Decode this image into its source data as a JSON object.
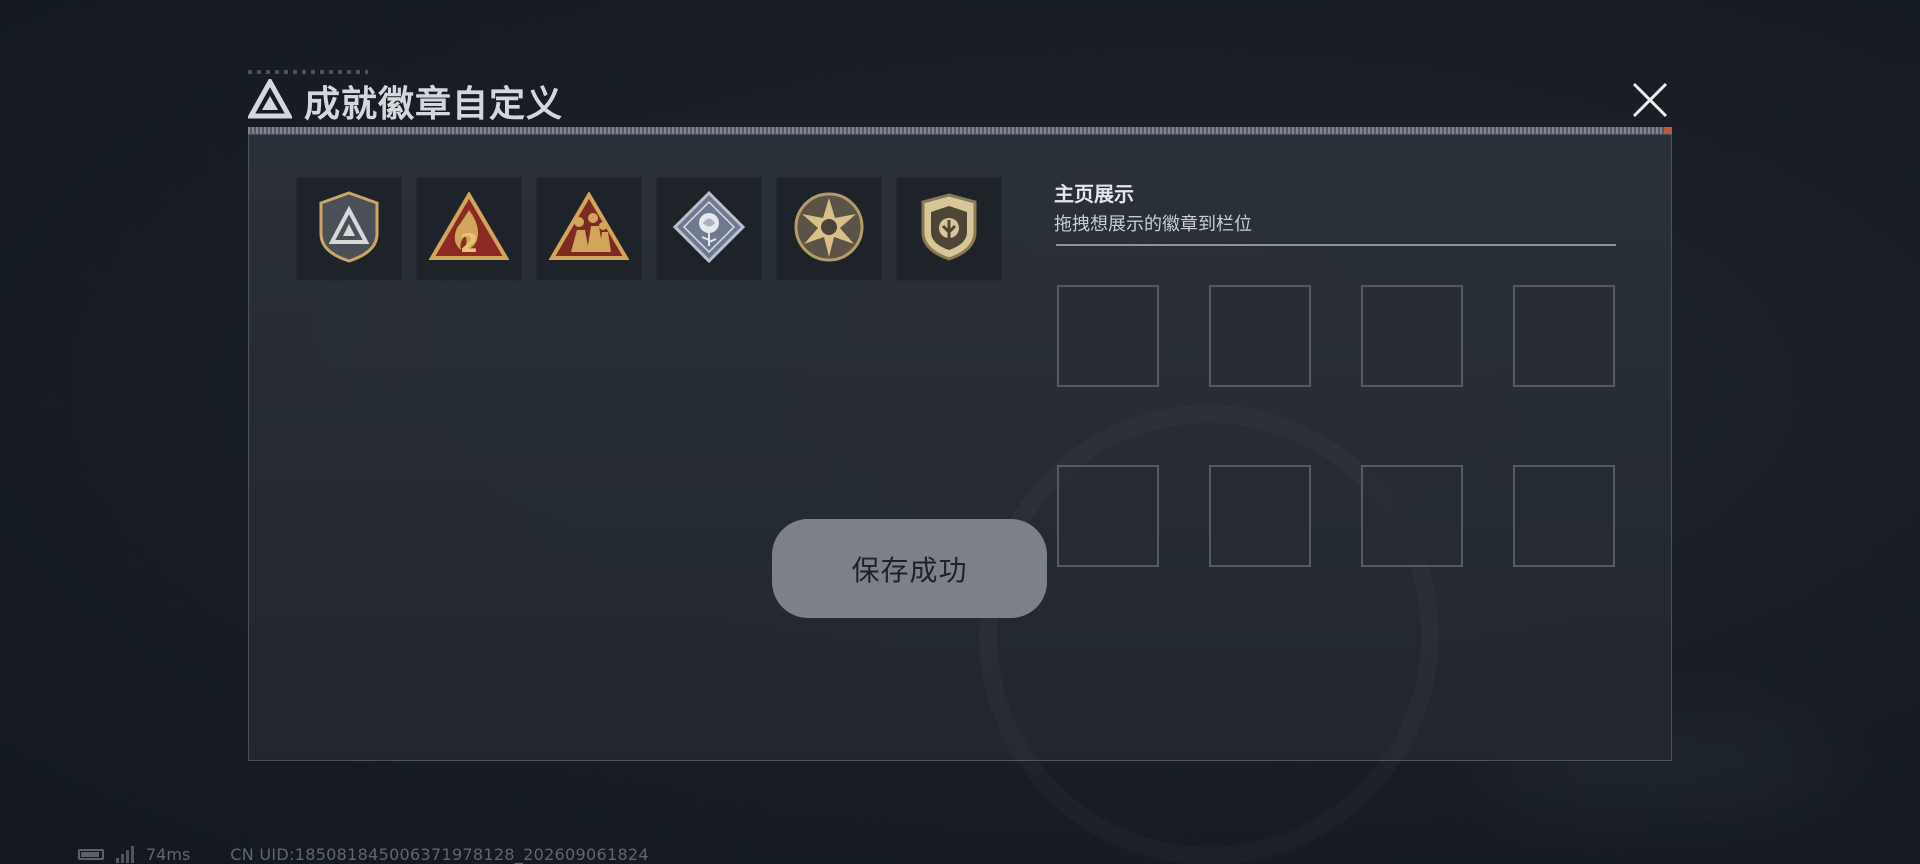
{
  "modal": {
    "title": "成就徽章自定义",
    "title_icon": "triangle-logo-icon",
    "close_icon": "close-icon"
  },
  "badges": [
    {
      "name": "shield-triangle-badge-icon"
    },
    {
      "name": "flame-two-badge-icon"
    },
    {
      "name": "soldiers-triangle-badge-icon"
    },
    {
      "name": "rose-diamond-badge-icon"
    },
    {
      "name": "star-circle-badge-icon"
    },
    {
      "name": "wing-shield-badge-icon"
    }
  ],
  "showcase": {
    "title": "主页展示",
    "description": "拖拽想展示的徽章到栏位"
  },
  "toast": {
    "message": "保存成功"
  },
  "footer": {
    "ping": "74ms",
    "uid": "CN UID:18508184500637197812​8_202609061824"
  },
  "colors": {
    "gold": "#c9a866",
    "accent_red": "#c2573a",
    "toast_bg": "#7c8089"
  }
}
